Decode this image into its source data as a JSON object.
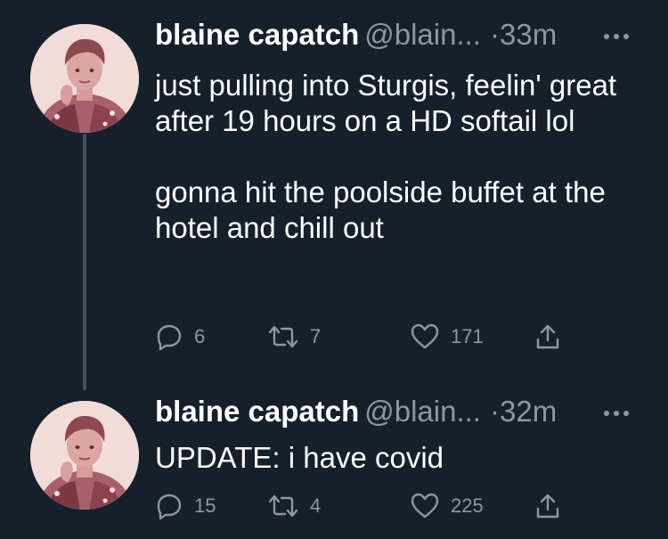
{
  "tweets": [
    {
      "author": {
        "name": "blaine capatch",
        "handle": "@blain...",
        "avatar_icon": "profile-photo"
      },
      "separator": "·",
      "time": "33m",
      "body": [
        "just pulling into Sturgis, feelin' great after 19 hours on a HD softail lol",
        "gonna hit the poolside buffet at the hotel and chill out"
      ],
      "actions": {
        "replies": "6",
        "retweets": "7",
        "likes": "171"
      }
    },
    {
      "author": {
        "name": "blaine capatch",
        "handle": "@blain...",
        "avatar_icon": "profile-photo"
      },
      "separator": "·",
      "time": "32m",
      "body": [
        "UPDATE: i have covid"
      ],
      "actions": {
        "replies": "15",
        "retweets": "4",
        "likes": "225"
      }
    }
  ],
  "colors": {
    "background": "#15202b",
    "text_primary": "#ffffff",
    "text_secondary": "#8899a6",
    "thread_line": "#3d5466"
  },
  "icons": {
    "more": "more-icon",
    "reply": "reply-icon",
    "retweet": "retweet-icon",
    "like": "like-icon",
    "share": "share-icon"
  }
}
